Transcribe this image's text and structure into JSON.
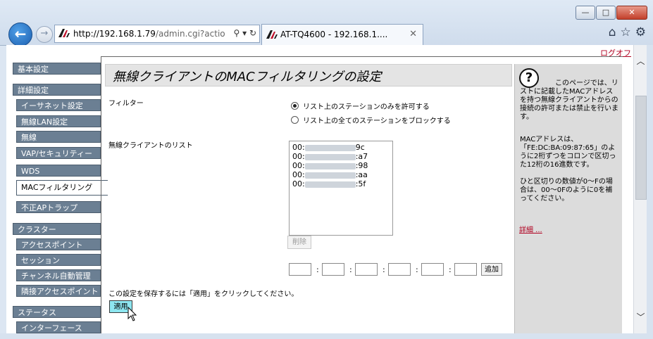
{
  "browser": {
    "url_host": "http://192.168.1.79",
    "url_path": "/admin.cgi?actio",
    "tab_title": "AT-TQ4600 - 192.168.1....",
    "window_controls": [
      "minimize",
      "maximize",
      "close"
    ]
  },
  "header": {
    "logoff": "ログオフ"
  },
  "sidebar": {
    "items": [
      {
        "label": "基本設定"
      },
      {
        "label": "詳細設定"
      },
      {
        "label": "イーサネット設定"
      },
      {
        "label": "無線LAN設定"
      },
      {
        "label": "無線"
      },
      {
        "label": "VAP/セキュリティー"
      },
      {
        "label": "WDS"
      },
      {
        "label": "MACフィルタリング"
      },
      {
        "label": "不正APトラップ"
      },
      {
        "label": "クラスター"
      },
      {
        "label": "アクセスポイント"
      },
      {
        "label": "セッション"
      },
      {
        "label": "チャンネル自動管理"
      },
      {
        "label": "隣接アクセスポイント"
      },
      {
        "label": "ステータス"
      },
      {
        "label": "インターフェース"
      }
    ]
  },
  "main": {
    "title": "無線クライアントのMACフィルタリングの設定",
    "filter_label": "フィルター",
    "filter_options": [
      {
        "label": "リスト上のステーションのみを許可する",
        "selected": true
      },
      {
        "label": "リスト上の全てのステーションをブロックする",
        "selected": false
      }
    ],
    "client_list_label": "無線クライアントのリスト",
    "client_list": [
      {
        "prefix": "00:",
        "suffix": "9c"
      },
      {
        "prefix": "00:",
        "suffix": ":a7"
      },
      {
        "prefix": "00:",
        "suffix": ":98"
      },
      {
        "prefix": "00:",
        "suffix": ":aa"
      },
      {
        "prefix": "00:",
        "suffix": ":5f"
      }
    ],
    "delete_button": "削除",
    "add_button": "追加",
    "mac_separator": ":",
    "save_note": "この設定を保存するには「適用」をクリックしてください。",
    "apply_button": "適用"
  },
  "help": {
    "intro": "このページでは、リストに記載したMACアドレスを持つ無線クライアントからの接続の許可または禁止を行います。",
    "mac_note": "MACアドレスは、「FE:DC:BA:09:87:65」のように2桁ずつをコロンで区切った12桁の16進数です。",
    "digit_note": "ひと区切りの数値が0～Fの場合は、00～0Fのように0を補ってください。",
    "details_link": "詳細 ..."
  }
}
